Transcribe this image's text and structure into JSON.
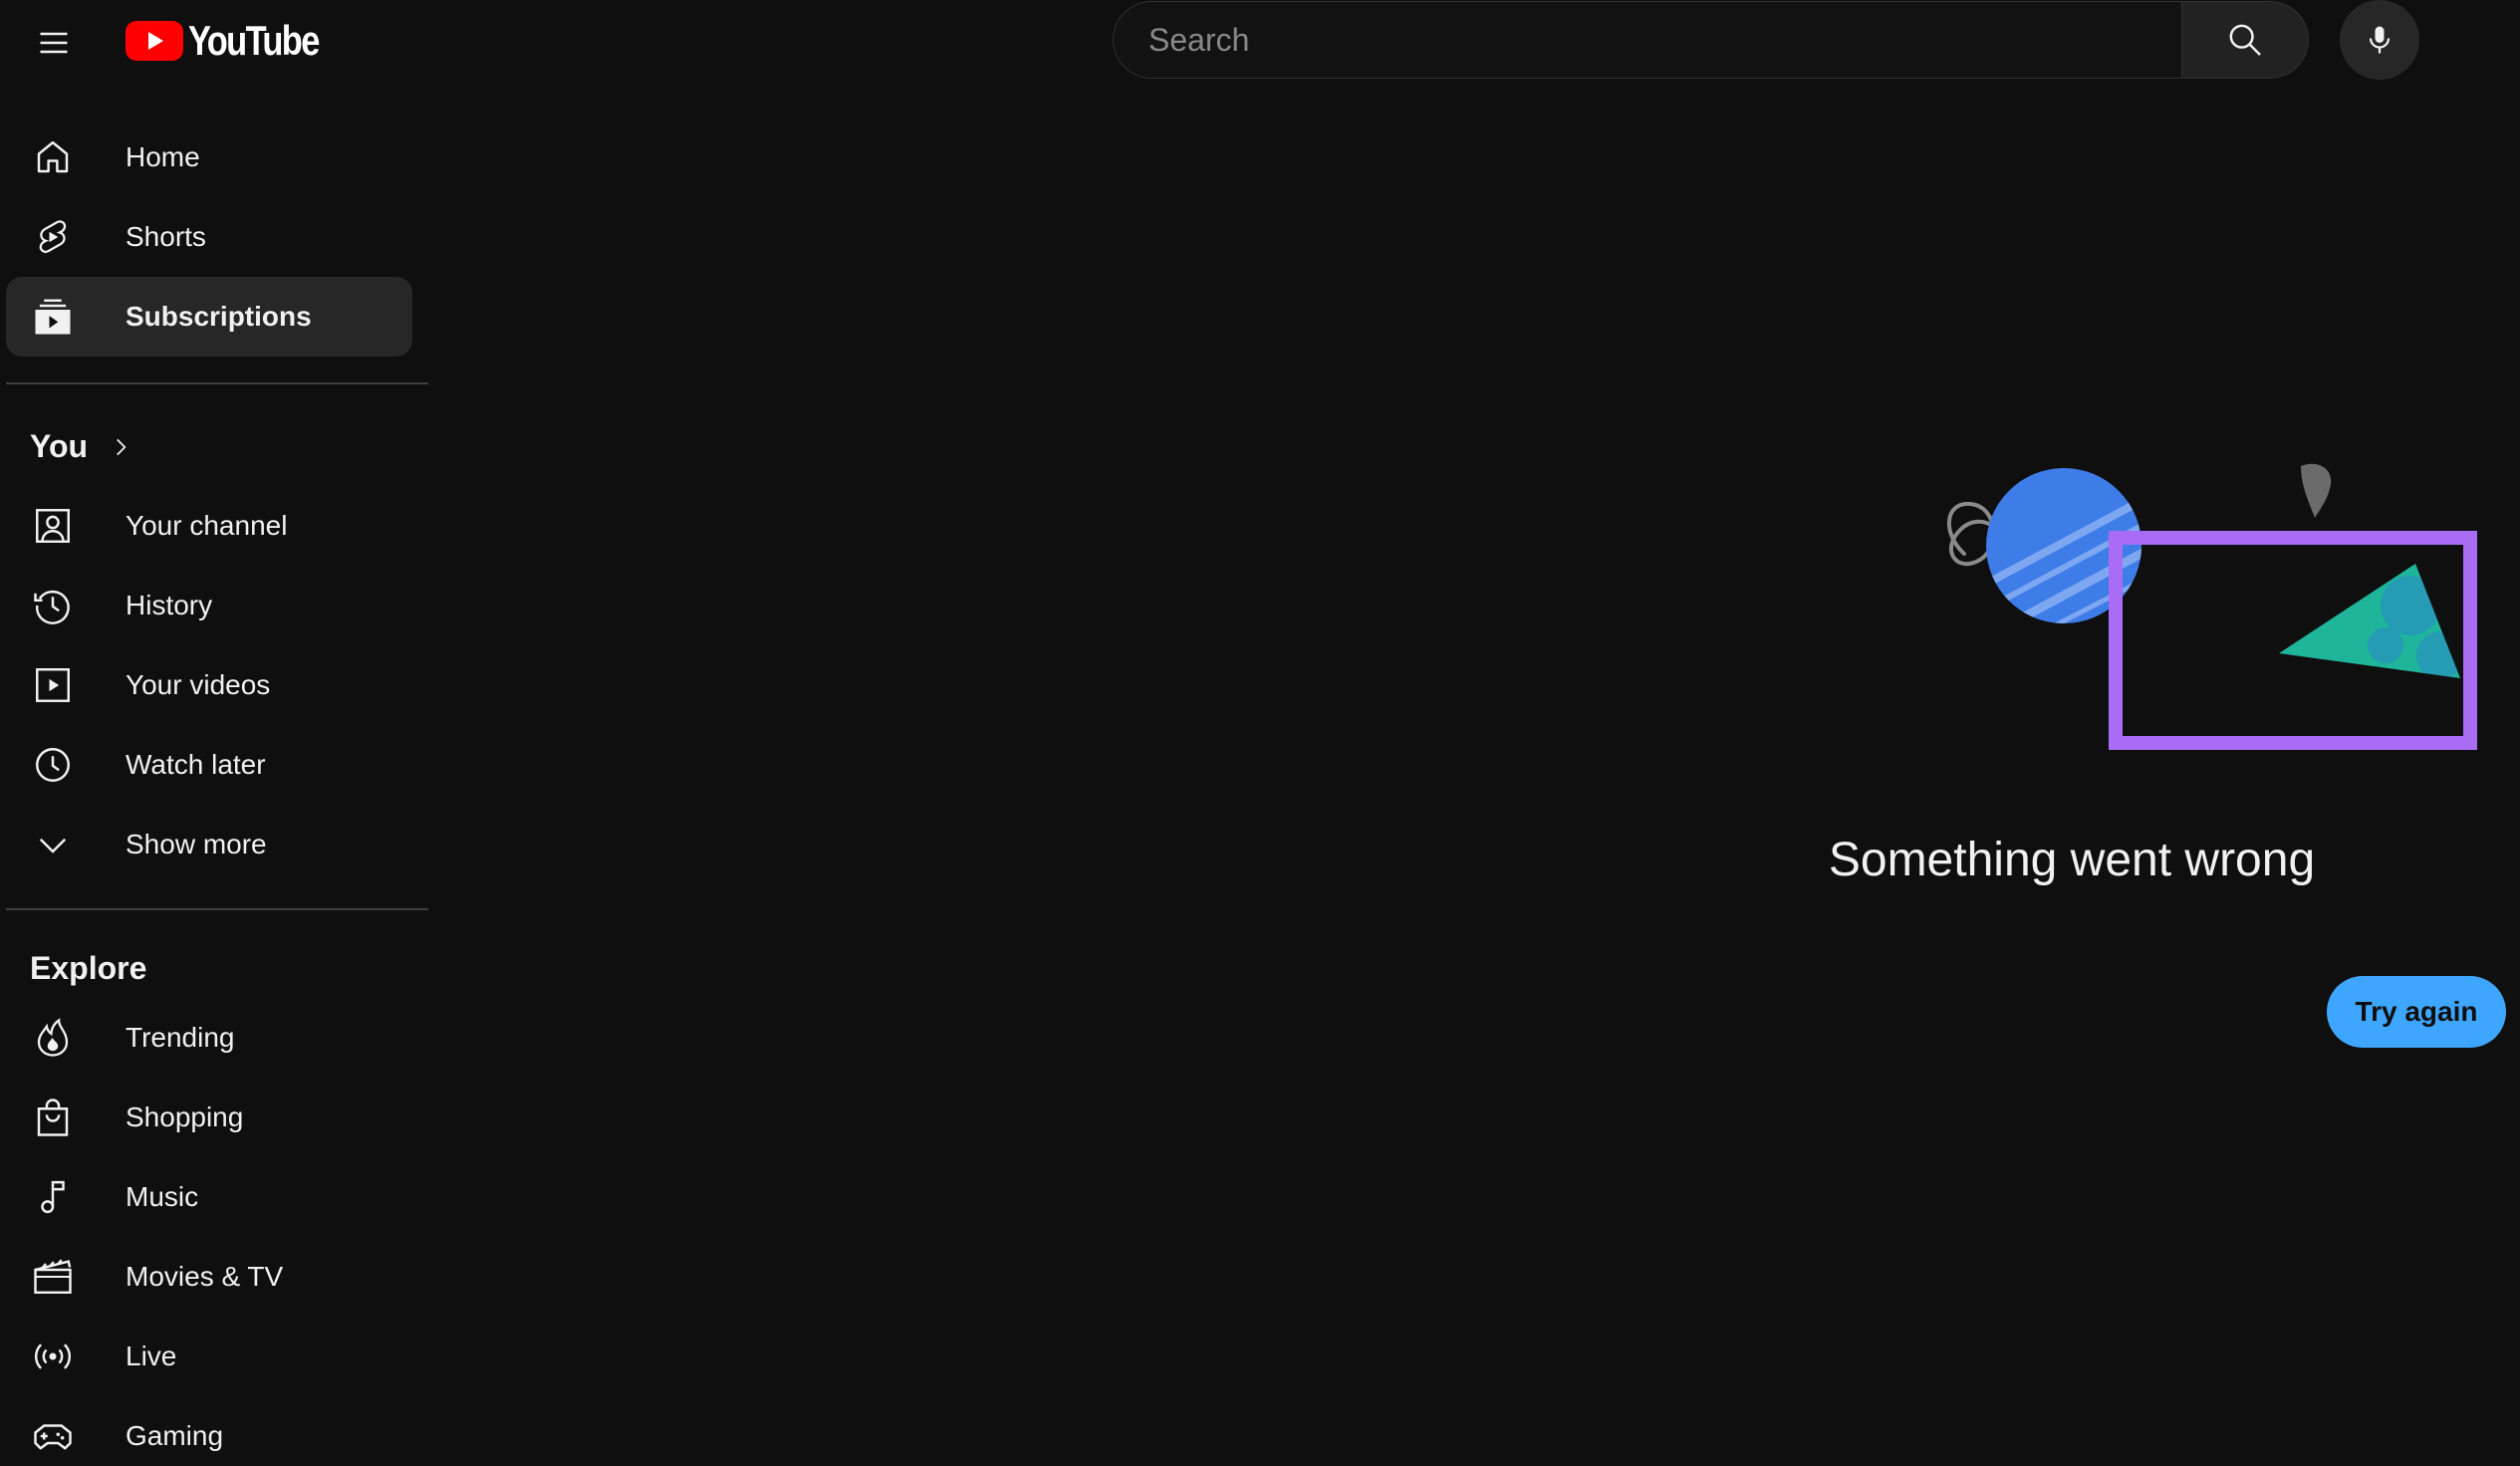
{
  "brand": {
    "name": "YouTube",
    "accent": "#ff0000"
  },
  "search": {
    "placeholder": "Search"
  },
  "sidebar": {
    "primary": [
      {
        "label": "Home",
        "icon": "home-icon"
      },
      {
        "label": "Shorts",
        "icon": "shorts-icon"
      },
      {
        "label": "Subscriptions",
        "icon": "subscriptions-icon",
        "active": true
      }
    ],
    "you": {
      "title": "You",
      "items": [
        {
          "label": "Your channel",
          "icon": "your-channel-icon"
        },
        {
          "label": "History",
          "icon": "history-icon"
        },
        {
          "label": "Your videos",
          "icon": "your-videos-icon"
        },
        {
          "label": "Watch later",
          "icon": "watch-later-icon"
        },
        {
          "label": "Show more",
          "icon": "chevron-down-icon"
        }
      ]
    },
    "explore": {
      "title": "Explore",
      "items": [
        {
          "label": "Trending",
          "icon": "trending-icon"
        },
        {
          "label": "Shopping",
          "icon": "shopping-icon"
        },
        {
          "label": "Music",
          "icon": "music-icon"
        },
        {
          "label": "Movies & TV",
          "icon": "movies-icon"
        },
        {
          "label": "Live",
          "icon": "live-icon"
        },
        {
          "label": "Gaming",
          "icon": "gaming-icon"
        }
      ]
    }
  },
  "error": {
    "message": "Something went wrong",
    "retry_label": "Try again",
    "button_color": "#3ea6ff"
  }
}
